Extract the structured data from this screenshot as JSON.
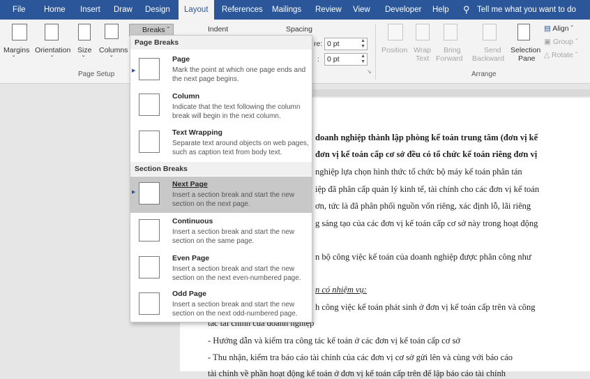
{
  "tabs": [
    "File",
    "Home",
    "Insert",
    "Draw",
    "Design",
    "Layout",
    "References",
    "Mailings",
    "Review",
    "View",
    "Developer",
    "Help"
  ],
  "tell_me": "Tell me what you want to do",
  "ribbon": {
    "margins": "Margins",
    "orientation": "Orientation",
    "size": "Size",
    "columns": "Columns",
    "breaks": "Breaks",
    "indent": "Indent",
    "spacing": "Spacing",
    "before_label": "re:",
    "after_label": ":",
    "before_value": "0 pt",
    "after_value": "0 pt",
    "position": "Position",
    "wrap_text_1": "Wrap",
    "wrap_text_2": "Text",
    "bring_forward_1": "Bring",
    "bring_forward_2": "Forward",
    "send_backward_1": "Send",
    "send_backward_2": "Backward",
    "selection_pane_1": "Selection",
    "selection_pane_2": "Pane",
    "align": "Align",
    "group": "Group",
    "rotate": "Rotate",
    "group_page_setup": "Page Setup",
    "group_arrange": "Arrange"
  },
  "breaks_menu": {
    "page_breaks_header": "Page Breaks",
    "section_breaks_header": "Section Breaks",
    "items": [
      {
        "title": "Page",
        "desc": "Mark the point at which one page ends and the next page begins."
      },
      {
        "title": "Column",
        "desc": "Indicate that the text following the column break will begin in the next column."
      },
      {
        "title": "Text Wrapping",
        "desc": "Separate text around objects on web pages, such as caption text from body text."
      },
      {
        "title": "Next Page",
        "desc": "Insert a section break and start the new section on the next page."
      },
      {
        "title": "Continuous",
        "desc": "Insert a section break and start the new section on the same page."
      },
      {
        "title": "Even Page",
        "desc": "Insert a section break and start the new section on the next even-numbered page."
      },
      {
        "title": "Odd Page",
        "desc": "Insert a section break and start the new section on the next odd-numbered page."
      }
    ]
  },
  "document": {
    "lines": [
      "doanh nghiệp thành lập phòng kế toán trung tâm (đơn vị kế",
      "đơn vị kế toán cấp cơ sở đều có tổ chức kế toán riêng đơn vị",
      "nghiệp lựa chọn hình thức tổ chức bộ máy kế toán phân tán",
      "iệp đã phân cấp quản lý kinh tế, tài chính cho các đơn vị kế toán",
      "ơn, tức là đã phân phối nguồn vốn riêng, xác định lỗ, lãi riêng",
      "g sáng tạo của các đơn vị kế toán cấp cơ sở này trong hoạt động",
      "n bộ công việc kế toán của doanh nghiệp được phân công như",
      "n có nhiệm vụ:",
      "h công việc kế toán phát sinh ở đơn vị kế toán cấp trên và công",
      "tác tài chính của doanh nghiệp",
      "-   Hướng dẫn và kiểm tra công tác kế toán ở các đơn vị kế toán cấp cơ sở",
      "-   Thu nhận, kiểm tra báo cáo tài chính của các đơn vị cơ sở gửi lên và  cùng với báo cáo",
      "tài chính về phần hoạt động kế toán ở đơn vị kế toán cấp trên để lập báo cáo tài chính"
    ]
  }
}
